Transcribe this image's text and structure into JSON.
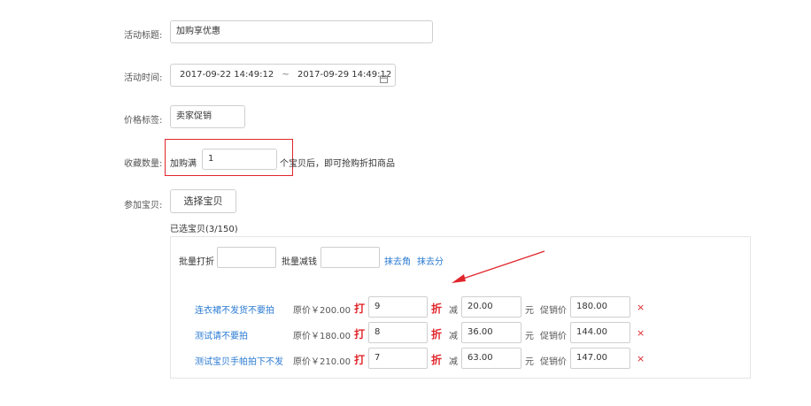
{
  "form": {
    "title": {
      "label": "活动标题:",
      "value": "加购享优惠"
    },
    "time": {
      "label": "活动时间:",
      "start": "2017-09-22 14:49:12",
      "sep": "~",
      "end": "2017-09-29 14:49:12",
      "icon": "calendar-icon"
    },
    "price_tag": {
      "label": "价格标签:",
      "value": "卖家促销"
    },
    "favorite": {
      "label": "收藏数量:",
      "prefix": "加购满",
      "value": "1",
      "suffix": "个宝贝后，即可抢购折扣商品"
    },
    "items": {
      "label": "参加宝贝:",
      "select_button": "选择宝贝",
      "selected_count": "已选宝贝(3/150)"
    }
  },
  "batch": {
    "discount_label": "批量打折",
    "reduce_label": "批量减钱",
    "round_jiao": "抹去角",
    "round_fen": "抹去分"
  },
  "products": [
    {
      "name": "连衣裙不发货不要拍",
      "orig": "原价￥200.00",
      "da": "打",
      "discount": "9",
      "zhe": "折",
      "jian": "减",
      "reduce": "20.00",
      "yuan": "元",
      "promo_label": "促销价",
      "promo": "180.00",
      "remove": "×"
    },
    {
      "name": "测试请不要拍",
      "orig": "原价￥180.00",
      "da": "打",
      "discount": "8",
      "zhe": "折",
      "jian": "减",
      "reduce": "36.00",
      "yuan": "元",
      "promo_label": "促销价",
      "promo": "144.00",
      "remove": "×"
    },
    {
      "name": "测试宝贝手帕拍下不发",
      "orig": "原价￥210.00",
      "da": "打",
      "discount": "7",
      "zhe": "折",
      "jian": "减",
      "reduce": "63.00",
      "yuan": "元",
      "promo_label": "促销价",
      "promo": "147.00",
      "remove": "×"
    }
  ],
  "colors": {
    "highlight": "#e0262b",
    "link": "#2a7ad2",
    "border": "#cfcfcf"
  }
}
